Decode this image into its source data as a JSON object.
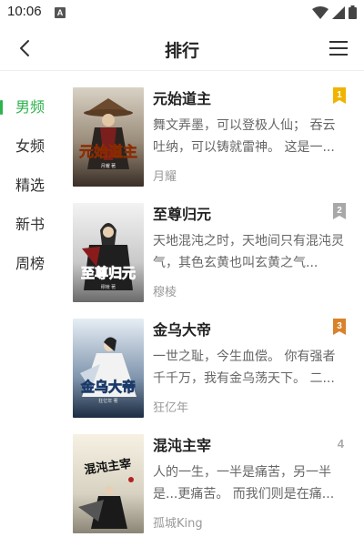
{
  "status_bar": {
    "time": "10:06",
    "notification_label": "A"
  },
  "header": {
    "title": "排行"
  },
  "sidebar": {
    "items": [
      {
        "label": "男频",
        "active": true
      },
      {
        "label": "女频",
        "active": false
      },
      {
        "label": "精选",
        "active": false
      },
      {
        "label": "新书",
        "active": false
      },
      {
        "label": "周榜",
        "active": false
      }
    ]
  },
  "books": [
    {
      "title": "元始道主",
      "desc": "舞文弄墨，可以登极人仙； 吞云吐纳，可以铸就雷神。 这是一...",
      "author": "月耀",
      "rank": "1",
      "cover_title": "元始道主",
      "cover_author": "月耀 著"
    },
    {
      "title": "至尊归元",
      "desc": "天地混沌之时，天地间只有混沌灵气，其色玄黄也叫玄黄之气...",
      "author": "穆棱",
      "rank": "2",
      "cover_title": "至尊归元",
      "cover_author": "穆棱 著"
    },
    {
      "title": "金乌大帝",
      "desc": "一世之耻，今生血偿。 你有强者千千万，我有金乌荡天下。 二...",
      "author": "狂亿年",
      "rank": "3",
      "cover_title": "金乌大帝",
      "cover_author": "狂亿年 著"
    },
    {
      "title": "混沌主宰",
      "desc": "人的一生，一半是痛苦，另一半是...更痛苦。 而我们则是在痛...",
      "author": "孤城King",
      "rank": "4",
      "cover_title": "混沌主宰"
    }
  ],
  "colors": {
    "accent": "#2eb34d",
    "rank1": "#f0b400",
    "rank2": "#a8a8a8",
    "rank3": "#d9822b"
  }
}
